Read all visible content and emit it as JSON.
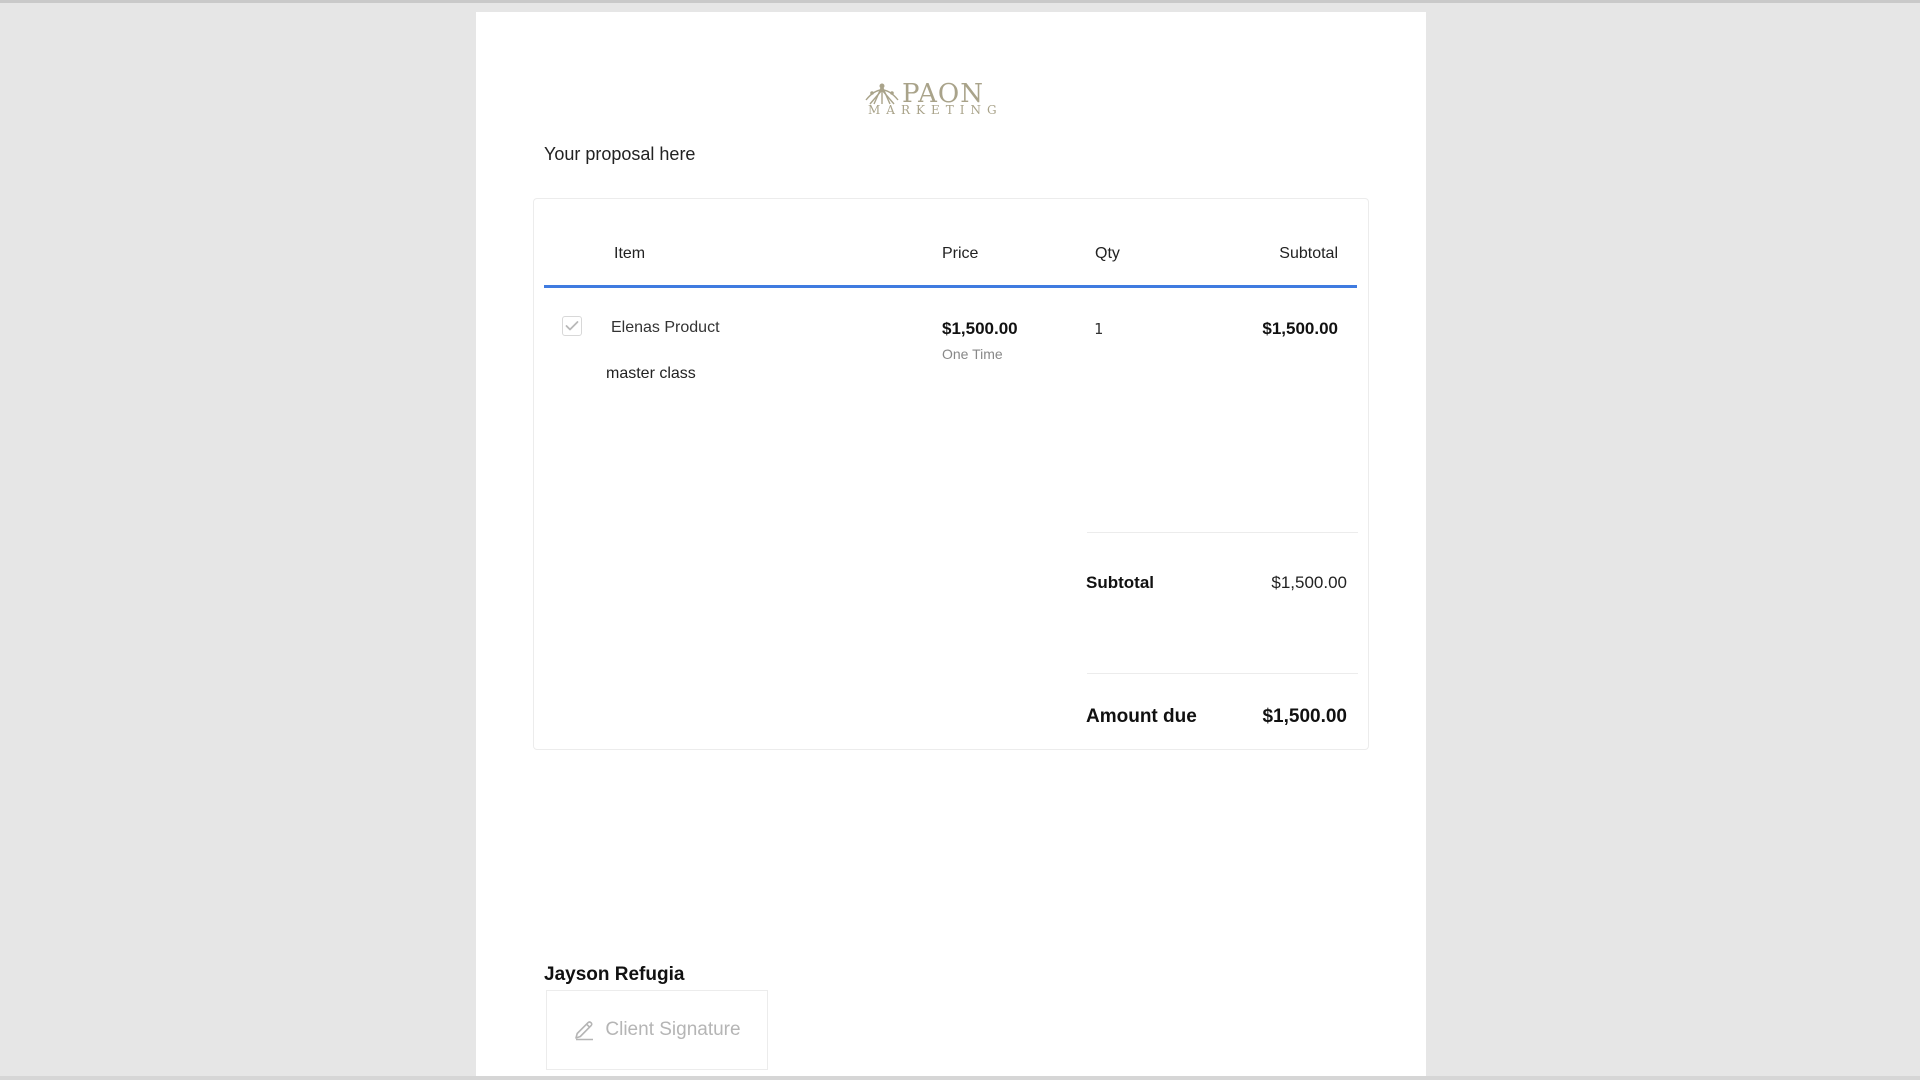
{
  "brand": {
    "logo_text_top": "PAON",
    "logo_text_bottom": "MARKETING",
    "logo_color": "#a9a38a"
  },
  "document": {
    "intro": "Your proposal here"
  },
  "table": {
    "headers": {
      "item": "Item",
      "price": "Price",
      "qty": "Qty",
      "subtotal": "Subtotal"
    },
    "rows": [
      {
        "checked": true,
        "name": "Elenas Product",
        "description": "master class",
        "price": "$1,500.00",
        "billing": "One Time",
        "qty": "1",
        "subtotal": "$1,500.00"
      }
    ]
  },
  "summary": {
    "subtotal_label": "Subtotal",
    "subtotal_value": "$1,500.00",
    "amount_due_label": "Amount due",
    "amount_due_value": "$1,500.00"
  },
  "signature": {
    "signer_name": "Jayson Refugia",
    "placeholder": "Client Signature",
    "icon": "pen-icon"
  },
  "colors": {
    "accent": "#3f7be0",
    "background": "#e6e6e6",
    "page": "#ffffff"
  }
}
